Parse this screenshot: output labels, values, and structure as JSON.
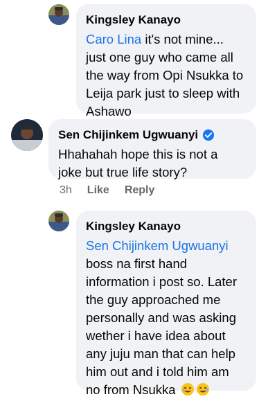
{
  "comments": [
    {
      "author": "Kingsley Kanayo",
      "mention": "Caro Lina",
      "lines": [
        "it's not mine...",
        "just one guy who came all",
        "the way from Opi Nsukka to",
        "Leija park just to sleep with",
        "Ashawo"
      ]
    },
    {
      "author": "Sen Chijinkem Ugwuanyi",
      "verified": true,
      "lines": [
        "Hhahahah hope this is not a",
        "joke but true life story?"
      ],
      "actions": {
        "time": "3h",
        "like": "Like",
        "reply": "Reply"
      }
    },
    {
      "author": "Kingsley Kanayo",
      "mention": "Sen Chijinkem Ugwuanyi",
      "lines": [
        "boss na first hand",
        "information i post so. Later",
        "the guy approached me",
        "personally and was asking",
        "wether i have idea about",
        "any juju man that can help",
        "him out and i told him am",
        "no from Nsukka"
      ],
      "emojis": [
        "rolling-on-floor-laughing-icon",
        "rolling-on-floor-laughing-icon"
      ]
    }
  ],
  "colors": {
    "bubble": "#f0f2f5",
    "mention": "#1b74e4",
    "meta": "#65676b",
    "verified": "#1877f2"
  }
}
